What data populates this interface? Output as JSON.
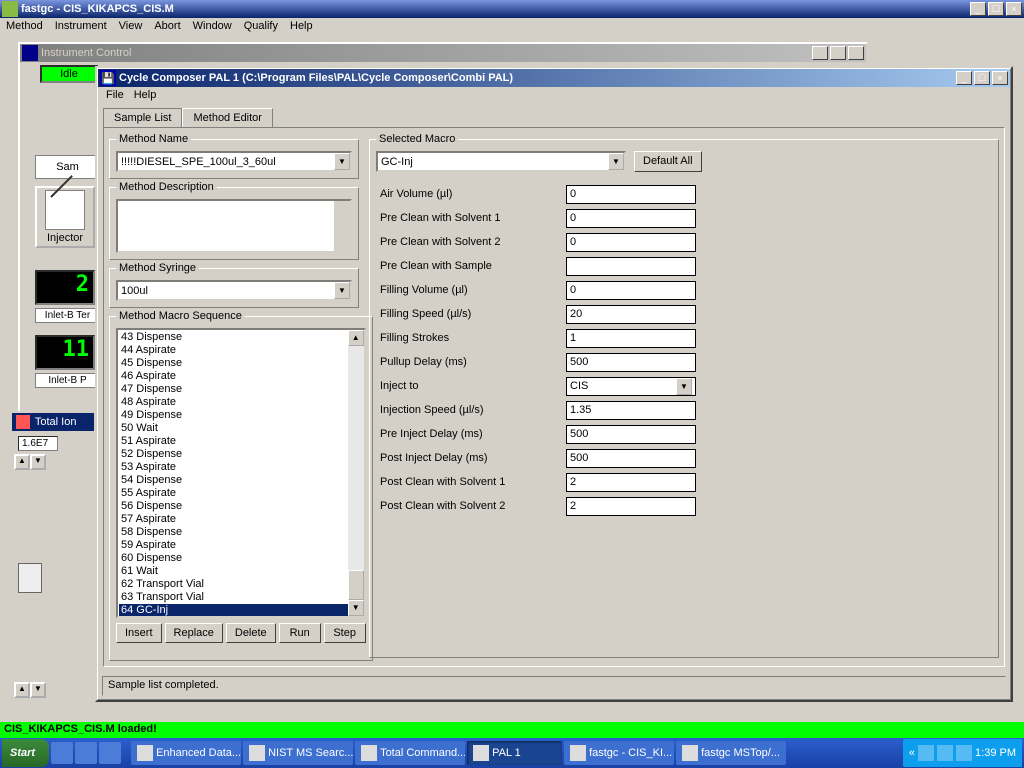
{
  "main_window": {
    "title": "fastgc - CIS_KIKAPCS_CIS.M",
    "menu": [
      "Method",
      "Instrument",
      "View",
      "Abort",
      "Window",
      "Qualify",
      "Help"
    ]
  },
  "instrument_window": {
    "title": "Instrument Control"
  },
  "idle_label": "Idle",
  "sam_label": "Sam",
  "injector_label": "Injector",
  "readout1": {
    "value": "2",
    "label": "Inlet-B Ter"
  },
  "readout2": {
    "value": "11",
    "label": "Inlet-B P"
  },
  "totalion_label": "Total Ion",
  "chart_value": "1.6E7",
  "cycle_window": {
    "title": "Cycle Composer  PAL 1  (C:\\Program Files\\PAL\\Cycle Composer\\Combi PAL)",
    "menu": [
      "File",
      "Help"
    ],
    "tabs": [
      "Sample List",
      "Method Editor"
    ],
    "active_tab": 1,
    "method_name_label": "Method Name",
    "method_name": "!!!!!DIESEL_SPE_100ul_3_60ul",
    "method_desc_label": "Method Description",
    "method_desc": "",
    "method_syringe_label": "Method Syringe",
    "method_syringe": "100ul",
    "macro_seq_label": "Method Macro Sequence",
    "macro_items": [
      "43 Dispense",
      "44 Aspirate",
      "45 Dispense",
      "46 Aspirate",
      "47 Dispense",
      "48 Aspirate",
      "49 Dispense",
      "50 Wait",
      "51 Aspirate",
      "52 Dispense",
      "53 Aspirate",
      "54 Dispense",
      "55 Aspirate",
      "56 Dispense",
      "57 Aspirate",
      "58 Dispense",
      "59 Aspirate",
      "60 Dispense",
      "61 Wait",
      "62 Transport Vial",
      "63 Transport Vial",
      "64 GC-Inj"
    ],
    "macro_selected_index": 21,
    "buttons": [
      "Insert",
      "Replace",
      "Delete",
      "Run",
      "Step"
    ],
    "selected_macro_label": "Selected Macro",
    "selected_macro": "GC-Inj",
    "default_all": "Default All",
    "params": [
      {
        "label": "Air Volume  (µl)",
        "value": "0",
        "type": "text"
      },
      {
        "label": "Pre Clean with Solvent 1",
        "value": "0",
        "type": "text"
      },
      {
        "label": "Pre Clean with Solvent 2",
        "value": "0",
        "type": "text"
      },
      {
        "label": "Pre Clean with Sample",
        "value": "",
        "type": "text"
      },
      {
        "label": "Filling Volume  (µl)",
        "value": "0",
        "type": "text"
      },
      {
        "label": "Filling Speed  (µl/s)",
        "value": "20",
        "type": "text"
      },
      {
        "label": "Filling Strokes",
        "value": "1",
        "type": "text"
      },
      {
        "label": "Pullup Delay  (ms)",
        "value": "500",
        "type": "text"
      },
      {
        "label": "Inject to",
        "value": "CIS",
        "type": "dropdown"
      },
      {
        "label": "Injection Speed  (µl/s)",
        "value": "1.35",
        "type": "text"
      },
      {
        "label": "Pre Inject Delay  (ms)",
        "value": "500",
        "type": "text"
      },
      {
        "label": "Post Inject Delay  (ms)",
        "value": "500",
        "type": "text"
      },
      {
        "label": "Post Clean with Solvent 1",
        "value": "2",
        "type": "text"
      },
      {
        "label": "Post Clean with Solvent 2",
        "value": "2",
        "type": "text"
      }
    ],
    "status": "Sample list completed."
  },
  "bottom_status": "CIS_KIKAPCS_CIS.M loaded!",
  "taskbar": {
    "start": "Start",
    "tasks": [
      {
        "label": "Enhanced Data...",
        "active": false
      },
      {
        "label": "NIST MS Searc...",
        "active": false
      },
      {
        "label": "Total Command...",
        "active": false
      },
      {
        "label": "PAL 1",
        "active": true
      },
      {
        "label": "fastgc - CIS_KI...",
        "active": false
      },
      {
        "label": "fastgc MSTop/...",
        "active": false
      }
    ],
    "time": "1:39 PM"
  }
}
